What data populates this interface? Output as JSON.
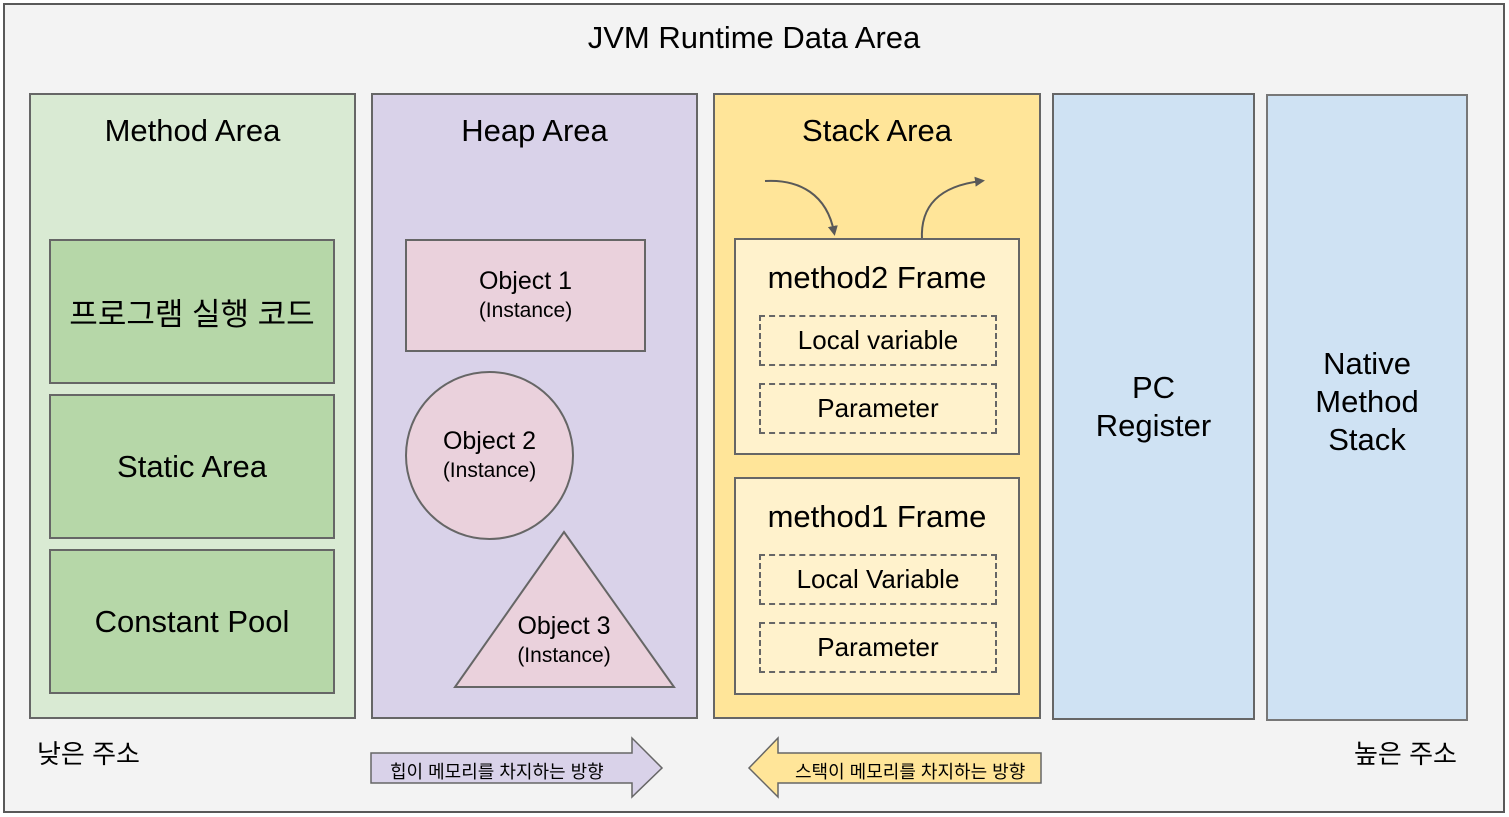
{
  "diagram": {
    "title": "JVM Runtime Data Area",
    "method_area": {
      "title": "Method Area",
      "items": [
        "프로그램 실행 코드",
        "Static Area",
        "Constant Pool"
      ]
    },
    "heap_area": {
      "title": "Heap Area",
      "objects": [
        {
          "name": "Object 1",
          "sub": "(Instance)",
          "shape": "rectangle"
        },
        {
          "name": "Object 2",
          "sub": "(Instance)",
          "shape": "circle"
        },
        {
          "name": "Object 3",
          "sub": "(Instance)",
          "shape": "triangle"
        }
      ]
    },
    "stack_area": {
      "title": "Stack Area",
      "frames": [
        {
          "title": "method2 Frame",
          "fields": [
            "Local variable",
            "Parameter"
          ]
        },
        {
          "title": "method1 Frame",
          "fields": [
            "Local Variable",
            "Parameter"
          ]
        }
      ]
    },
    "pc_register": {
      "line1": "PC",
      "line2": "Register"
    },
    "native_method_stack": {
      "line1": "Native",
      "line2": "Method",
      "line3": "Stack"
    },
    "low_address": "낮은 주소",
    "high_address": "높은 주소",
    "heap_direction": "힙이 메모리를 차지하는 방향",
    "stack_direction": "스택이 메모리를 차지하는 방향"
  },
  "colors": {
    "background": "#f3f3f3",
    "method_area": "#d9ead3",
    "method_items": "#b6d7a8",
    "heap_area": "#d9d2e9",
    "heap_objects": "#ead1dc",
    "stack_area": "#ffe599",
    "stack_frame": "#fff2cc",
    "pc_native": "#cfe2f3",
    "border": "#666666"
  }
}
